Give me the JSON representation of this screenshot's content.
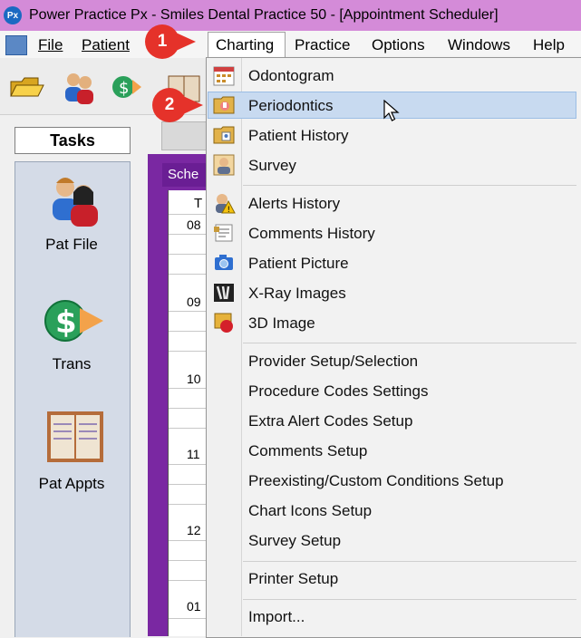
{
  "window": {
    "title": "Power Practice Px - Smiles Dental Practice 50 - [Appointment Scheduler]",
    "logo_text": "Px"
  },
  "menubar": {
    "items": [
      {
        "label": "File"
      },
      {
        "label": "Patient"
      },
      {
        "label": "Charting",
        "active": true
      },
      {
        "label": "Practice"
      },
      {
        "label": "Options"
      },
      {
        "label": "Windows"
      },
      {
        "label": "Help"
      }
    ]
  },
  "tasks": {
    "header": "Tasks",
    "items": [
      {
        "label": "Pat File",
        "icon": "patient-file-icon"
      },
      {
        "label": "Trans",
        "icon": "transactions-icon"
      },
      {
        "label": "Pat Appts",
        "icon": "patient-appointments-icon"
      }
    ]
  },
  "scheduler": {
    "tab_label": "Sche",
    "column_header": "T",
    "hours": [
      "08",
      "09",
      "10",
      "11",
      "12",
      "01"
    ]
  },
  "charting_menu": {
    "groups": [
      [
        {
          "label": "Odontogram",
          "icon": "odontogram-icon"
        },
        {
          "label": "Periodontics",
          "icon": "periodontics-icon",
          "highlighted": true
        },
        {
          "label": "Patient History",
          "icon": "patient-history-icon"
        },
        {
          "label": "Survey",
          "icon": "survey-icon"
        }
      ],
      [
        {
          "label": "Alerts History",
          "icon": "alerts-icon"
        },
        {
          "label": "Comments History",
          "icon": "comments-icon"
        },
        {
          "label": "Patient Picture",
          "icon": "camera-icon"
        },
        {
          "label": "X-Ray Images",
          "icon": "xray-icon"
        },
        {
          "label": "3D Image",
          "icon": "3d-image-icon"
        }
      ],
      [
        {
          "label": "Provider Setup/Selection"
        },
        {
          "label": "Procedure Codes Settings"
        },
        {
          "label": "Extra Alert Codes Setup"
        },
        {
          "label": "Comments Setup"
        },
        {
          "label": "Preexisting/Custom Conditions Setup"
        },
        {
          "label": "Chart Icons Setup"
        },
        {
          "label": "Survey Setup"
        }
      ],
      [
        {
          "label": "Printer Setup"
        }
      ],
      [
        {
          "label": "Import..."
        }
      ]
    ]
  },
  "callouts": [
    {
      "label": "1"
    },
    {
      "label": "2"
    }
  ],
  "colors": {
    "titlebar": "#d48bd8",
    "highlight": "#c8daf0",
    "callout": "#e5322a",
    "scheduler_frame": "#7a28a2"
  }
}
